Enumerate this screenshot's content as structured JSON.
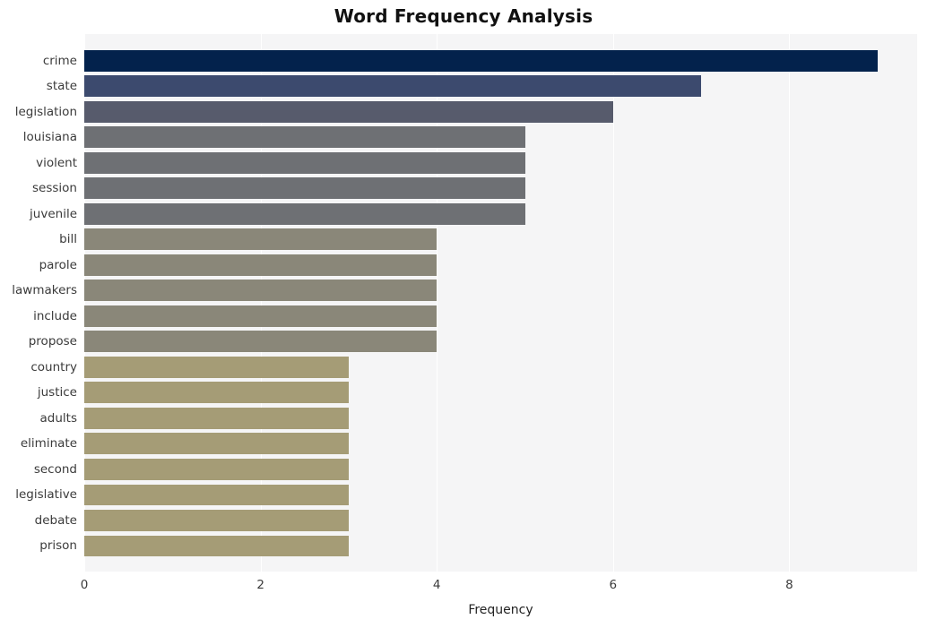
{
  "chart_data": {
    "type": "bar",
    "orientation": "horizontal",
    "title": "Word Frequency Analysis",
    "xlabel": "Frequency",
    "ylabel": "",
    "xlim": [
      0,
      9.45
    ],
    "xticks": [
      0,
      2,
      4,
      6,
      8
    ],
    "grid": true,
    "legend": "none",
    "categories": [
      "crime",
      "state",
      "legislation",
      "louisiana",
      "violent",
      "session",
      "juvenile",
      "bill",
      "parole",
      "lawmakers",
      "include",
      "propose",
      "country",
      "justice",
      "adults",
      "eliminate",
      "second",
      "legislative",
      "debate",
      "prison"
    ],
    "values": [
      9,
      7,
      6,
      5,
      5,
      5,
      5,
      4,
      4,
      4,
      4,
      4,
      3,
      3,
      3,
      3,
      3,
      3,
      3,
      3
    ],
    "bar_colors": [
      "#03224c",
      "#3c4a6e",
      "#575b6c",
      "#6e7074",
      "#6e7074",
      "#6e7074",
      "#6e7074",
      "#8a8779",
      "#8a8779",
      "#8a8779",
      "#8a8779",
      "#8a8779",
      "#a59c76",
      "#a59c76",
      "#a59c76",
      "#a59c76",
      "#a59c76",
      "#a59c76",
      "#a59c76",
      "#a59c76"
    ],
    "plot_background": "#f5f5f6",
    "figure_background": "#ffffff",
    "gridline_color": "#ffffff"
  }
}
